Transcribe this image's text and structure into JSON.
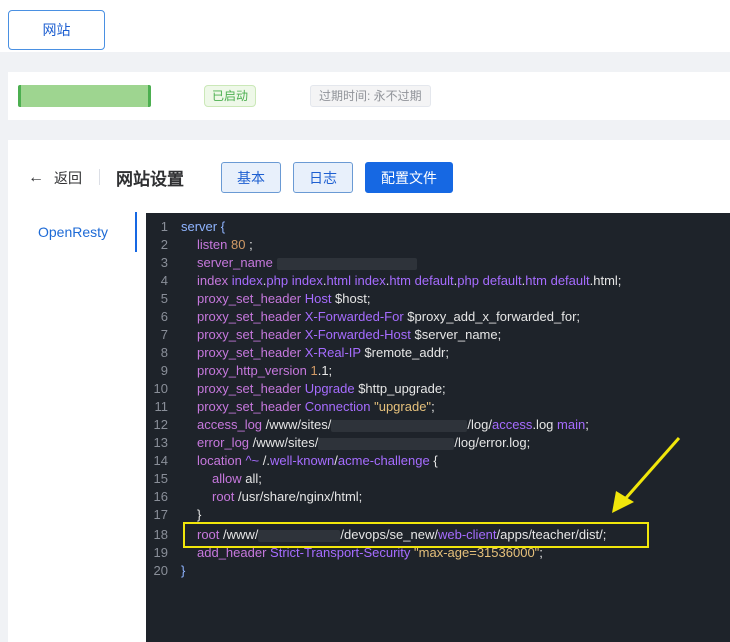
{
  "top": {
    "tab_label": "网站"
  },
  "status": {
    "site_name": "",
    "running_badge": "已启动",
    "expire_text": "过期时间: 永不过期"
  },
  "header": {
    "back_label": "返回",
    "title": "网站设置",
    "buttons": [
      "基本",
      "日志",
      "配置文件"
    ]
  },
  "sidebar": {
    "item": "OpenResty"
  },
  "colors": {
    "primary": "#1668e3",
    "success": "#4caf50",
    "editor_bg": "#1e232a",
    "highlight": "#f1e60b"
  },
  "editor": {
    "lines": [
      {
        "n": "1",
        "t": "server {"
      },
      {
        "n": "2",
        "t": "listen 80 ;"
      },
      {
        "n": "3",
        "t": "server_name"
      },
      {
        "n": "4",
        "t": "index index.php index.html index.htm default.php default.htm default.html;"
      },
      {
        "n": "5",
        "t": "proxy_set_header Host $host;"
      },
      {
        "n": "6",
        "t": "proxy_set_header X-Forwarded-For $proxy_add_x_forwarded_for;"
      },
      {
        "n": "7",
        "t": "proxy_set_header X-Forwarded-Host $server_name;"
      },
      {
        "n": "8",
        "t": "proxy_set_header X-Real-IP $remote_addr;"
      },
      {
        "n": "9",
        "t": "proxy_http_version 1.1;"
      },
      {
        "n": "10",
        "t": "proxy_set_header Upgrade $http_upgrade;"
      },
      {
        "n": "11",
        "t": "proxy_set_header Connection \"upgrade\";"
      },
      {
        "n": "12",
        "t": "access_log /www/sites/ /log/access.log main;"
      },
      {
        "n": "13",
        "t": "error_log /www/sites/ /log/error.log;"
      },
      {
        "n": "14",
        "t": "location ^~ /.well-known/acme-challenge {"
      },
      {
        "n": "15",
        "t": "allow all;"
      },
      {
        "n": "16",
        "t": "root /usr/share/nginx/html;"
      },
      {
        "n": "17",
        "t": "}"
      },
      {
        "n": "18",
        "t": "root /www/ /devops/se_new/web-client/apps/teacher/dist/;"
      },
      {
        "n": "19",
        "t": "add_header Strict-Transport-Security \"max-age=31536000\";"
      },
      {
        "n": "20",
        "t": "}"
      }
    ]
  }
}
